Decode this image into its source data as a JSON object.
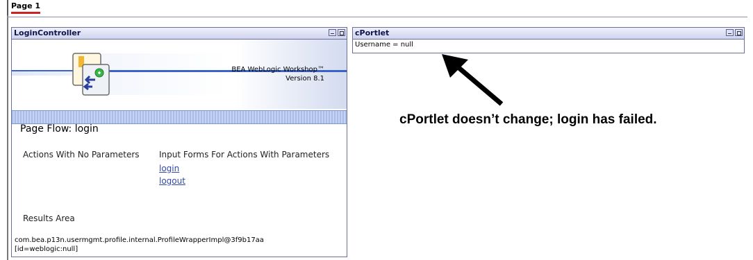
{
  "page": {
    "tab_label": "Page 1"
  },
  "login_portlet": {
    "title": "LoginController",
    "logo_line1": "BEA WebLogic Workshop™",
    "logo_line2": "Version 8.1",
    "page_flow": "Page Flow: login",
    "actions_header": "Actions With No Parameters",
    "forms_header": "Input Forms For Actions With Parameters",
    "links": [
      "login",
      "logout"
    ],
    "results_label": "Results Area",
    "result_line1": "com.bea.p13n.usermgmt.profile.internal.ProfileWrapperImpl@3f9b17aa",
    "result_line2": "[id=weblogic:null]"
  },
  "c_portlet": {
    "title": "cPortlet",
    "content": "Username = null"
  },
  "annotation": {
    "text": "cPortlet doesn’t change; login has failed."
  },
  "colors": {
    "accent": "#cc2222",
    "link": "#3049a8",
    "frame": "#6a6f9a"
  }
}
